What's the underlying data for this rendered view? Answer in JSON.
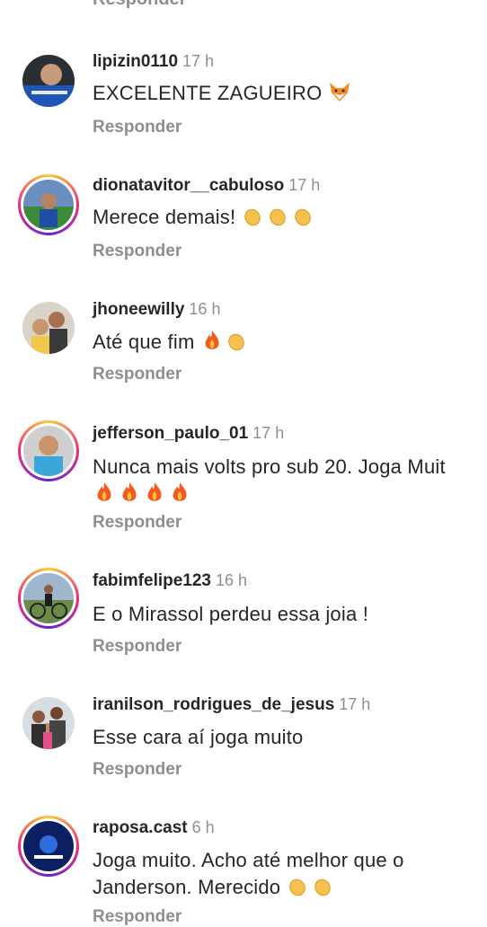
{
  "top_partial_reply": "Responder",
  "comments": [
    {
      "username": "lipizin0110",
      "time": "17 h",
      "text": "EXCELENTE ZAGUEIRO",
      "reply": "Responder",
      "emoji": "fox"
    },
    {
      "username": "dionatavitor__cabuloso",
      "time": "17 h",
      "text": "Merece demais!",
      "reply": "Responder",
      "emoji": "clap x3"
    },
    {
      "username": "jhoneewilly",
      "time": "16 h",
      "text": "Até que fim",
      "reply": "Responder",
      "emoji": "fire clap"
    },
    {
      "username": "jefferson_paulo_01",
      "time": "17 h",
      "text": "Nunca mais volts pro sub 20. Joga Muit",
      "reply": "Responder",
      "emoji": "fire x4"
    },
    {
      "username": "fabimfelipe123",
      "time": "16 h",
      "text": "E o Mirassol perdeu essa joia !",
      "reply": "Responder"
    },
    {
      "username": "iranilson_rodrigues_de_jesus",
      "time": "17 h",
      "text": "Esse cara aí joga muito",
      "reply": "Responder"
    },
    {
      "username": "raposa.cast",
      "time": "6 h",
      "text": "Joga muito. Acho até melhor que o Janderson. Merecido",
      "reply": "Responder",
      "emoji": "clap x2"
    }
  ],
  "colors": {
    "username": "#262626",
    "muted": "#8e8e8e",
    "story_ring": "#ee2a7b"
  }
}
